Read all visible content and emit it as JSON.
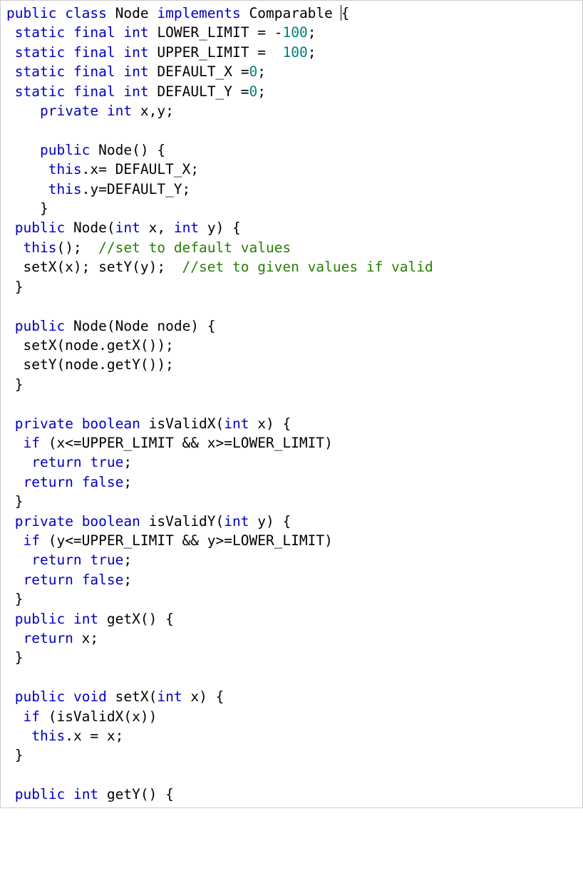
{
  "code": {
    "lines": [
      [
        [
          "kw",
          "public"
        ],
        [
          "p",
          " "
        ],
        [
          "kw",
          "class"
        ],
        [
          "p",
          " Node "
        ],
        [
          "kw",
          "implements"
        ],
        [
          "p",
          " Comparable "
        ],
        [
          "cursor",
          ""
        ],
        [
          "p",
          "{"
        ]
      ],
      [
        [
          "p",
          " "
        ],
        [
          "kw",
          "static"
        ],
        [
          "p",
          " "
        ],
        [
          "kw",
          "final"
        ],
        [
          "p",
          " "
        ],
        [
          "kw",
          "int"
        ],
        [
          "p",
          " LOWER_LIMIT = -"
        ],
        [
          "lit",
          "100"
        ],
        [
          "p",
          ";"
        ]
      ],
      [
        [
          "p",
          " "
        ],
        [
          "kw",
          "static"
        ],
        [
          "p",
          " "
        ],
        [
          "kw",
          "final"
        ],
        [
          "p",
          " "
        ],
        [
          "kw",
          "int"
        ],
        [
          "p",
          " UPPER_LIMIT =  "
        ],
        [
          "lit",
          "100"
        ],
        [
          "p",
          ";"
        ]
      ],
      [
        [
          "p",
          " "
        ],
        [
          "kw",
          "static"
        ],
        [
          "p",
          " "
        ],
        [
          "kw",
          "final"
        ],
        [
          "p",
          " "
        ],
        [
          "kw",
          "int"
        ],
        [
          "p",
          " DEFAULT_X ="
        ],
        [
          "lit",
          "0"
        ],
        [
          "p",
          ";"
        ]
      ],
      [
        [
          "p",
          " "
        ],
        [
          "kw",
          "static"
        ],
        [
          "p",
          " "
        ],
        [
          "kw",
          "final"
        ],
        [
          "p",
          " "
        ],
        [
          "kw",
          "int"
        ],
        [
          "p",
          " DEFAULT_Y ="
        ],
        [
          "lit",
          "0"
        ],
        [
          "p",
          ";"
        ]
      ],
      [
        [
          "p",
          "    "
        ],
        [
          "kw",
          "private"
        ],
        [
          "p",
          " "
        ],
        [
          "kw",
          "int"
        ],
        [
          "p",
          " x,y;"
        ]
      ],
      [
        [
          "p",
          ""
        ]
      ],
      [
        [
          "p",
          "    "
        ],
        [
          "kw",
          "public"
        ],
        [
          "p",
          " Node() {"
        ]
      ],
      [
        [
          "p",
          "     "
        ],
        [
          "kw",
          "this"
        ],
        [
          "p",
          ".x= DEFAULT_X;"
        ]
      ],
      [
        [
          "p",
          "     "
        ],
        [
          "kw",
          "this"
        ],
        [
          "p",
          ".y=DEFAULT_Y;"
        ]
      ],
      [
        [
          "p",
          "    }"
        ]
      ],
      [
        [
          "p",
          " "
        ],
        [
          "kw",
          "public"
        ],
        [
          "p",
          " Node("
        ],
        [
          "kw",
          "int"
        ],
        [
          "p",
          " x, "
        ],
        [
          "kw",
          "int"
        ],
        [
          "p",
          " y) {"
        ]
      ],
      [
        [
          "p",
          "  "
        ],
        [
          "kw",
          "this"
        ],
        [
          "p",
          "();  "
        ],
        [
          "cmt",
          "//set to default values"
        ]
      ],
      [
        [
          "p",
          "  setX(x); setY(y);  "
        ],
        [
          "cmt",
          "//set to given values if valid"
        ]
      ],
      [
        [
          "p",
          " }"
        ]
      ],
      [
        [
          "p",
          ""
        ]
      ],
      [
        [
          "p",
          " "
        ],
        [
          "kw",
          "public"
        ],
        [
          "p",
          " Node(Node node) {"
        ]
      ],
      [
        [
          "p",
          "  setX(node.getX());"
        ]
      ],
      [
        [
          "p",
          "  setY(node.getY());"
        ]
      ],
      [
        [
          "p",
          " }"
        ]
      ],
      [
        [
          "p",
          ""
        ]
      ],
      [
        [
          "p",
          " "
        ],
        [
          "kw",
          "private"
        ],
        [
          "p",
          " "
        ],
        [
          "kw",
          "boolean"
        ],
        [
          "p",
          " isValidX("
        ],
        [
          "kw",
          "int"
        ],
        [
          "p",
          " x) {"
        ]
      ],
      [
        [
          "p",
          "  "
        ],
        [
          "kw",
          "if"
        ],
        [
          "p",
          " (x<=UPPER_LIMIT && x>=LOWER_LIMIT)"
        ]
      ],
      [
        [
          "p",
          "   "
        ],
        [
          "kw",
          "return"
        ],
        [
          "p",
          " "
        ],
        [
          "kw",
          "true"
        ],
        [
          "p",
          ";"
        ]
      ],
      [
        [
          "p",
          "  "
        ],
        [
          "kw",
          "return"
        ],
        [
          "p",
          " "
        ],
        [
          "kw",
          "false"
        ],
        [
          "p",
          ";"
        ]
      ],
      [
        [
          "p",
          " }"
        ]
      ],
      [
        [
          "p",
          " "
        ],
        [
          "kw",
          "private"
        ],
        [
          "p",
          " "
        ],
        [
          "kw",
          "boolean"
        ],
        [
          "p",
          " isValidY("
        ],
        [
          "kw",
          "int"
        ],
        [
          "p",
          " y) {"
        ]
      ],
      [
        [
          "p",
          "  "
        ],
        [
          "kw",
          "if"
        ],
        [
          "p",
          " (y<=UPPER_LIMIT && y>=LOWER_LIMIT)"
        ]
      ],
      [
        [
          "p",
          "   "
        ],
        [
          "kw",
          "return"
        ],
        [
          "p",
          " "
        ],
        [
          "kw",
          "true"
        ],
        [
          "p",
          ";"
        ]
      ],
      [
        [
          "p",
          "  "
        ],
        [
          "kw",
          "return"
        ],
        [
          "p",
          " "
        ],
        [
          "kw",
          "false"
        ],
        [
          "p",
          ";"
        ]
      ],
      [
        [
          "p",
          " }"
        ]
      ],
      [
        [
          "p",
          " "
        ],
        [
          "kw",
          "public"
        ],
        [
          "p",
          " "
        ],
        [
          "kw",
          "int"
        ],
        [
          "p",
          " getX() {"
        ]
      ],
      [
        [
          "p",
          "  "
        ],
        [
          "kw",
          "return"
        ],
        [
          "p",
          " x;"
        ]
      ],
      [
        [
          "p",
          " }"
        ]
      ],
      [
        [
          "p",
          ""
        ]
      ],
      [
        [
          "p",
          " "
        ],
        [
          "kw",
          "public"
        ],
        [
          "p",
          " "
        ],
        [
          "kw",
          "void"
        ],
        [
          "p",
          " setX("
        ],
        [
          "kw",
          "int"
        ],
        [
          "p",
          " x) {"
        ]
      ],
      [
        [
          "p",
          "  "
        ],
        [
          "kw",
          "if"
        ],
        [
          "p",
          " (isValidX(x))"
        ]
      ],
      [
        [
          "p",
          "   "
        ],
        [
          "kw",
          "this"
        ],
        [
          "p",
          ".x = x;"
        ]
      ],
      [
        [
          "p",
          " }"
        ]
      ],
      [
        [
          "p",
          ""
        ]
      ],
      [
        [
          "p",
          " "
        ],
        [
          "kw",
          "public"
        ],
        [
          "p",
          " "
        ],
        [
          "kw",
          "int"
        ],
        [
          "p",
          " getY() {"
        ]
      ]
    ]
  }
}
